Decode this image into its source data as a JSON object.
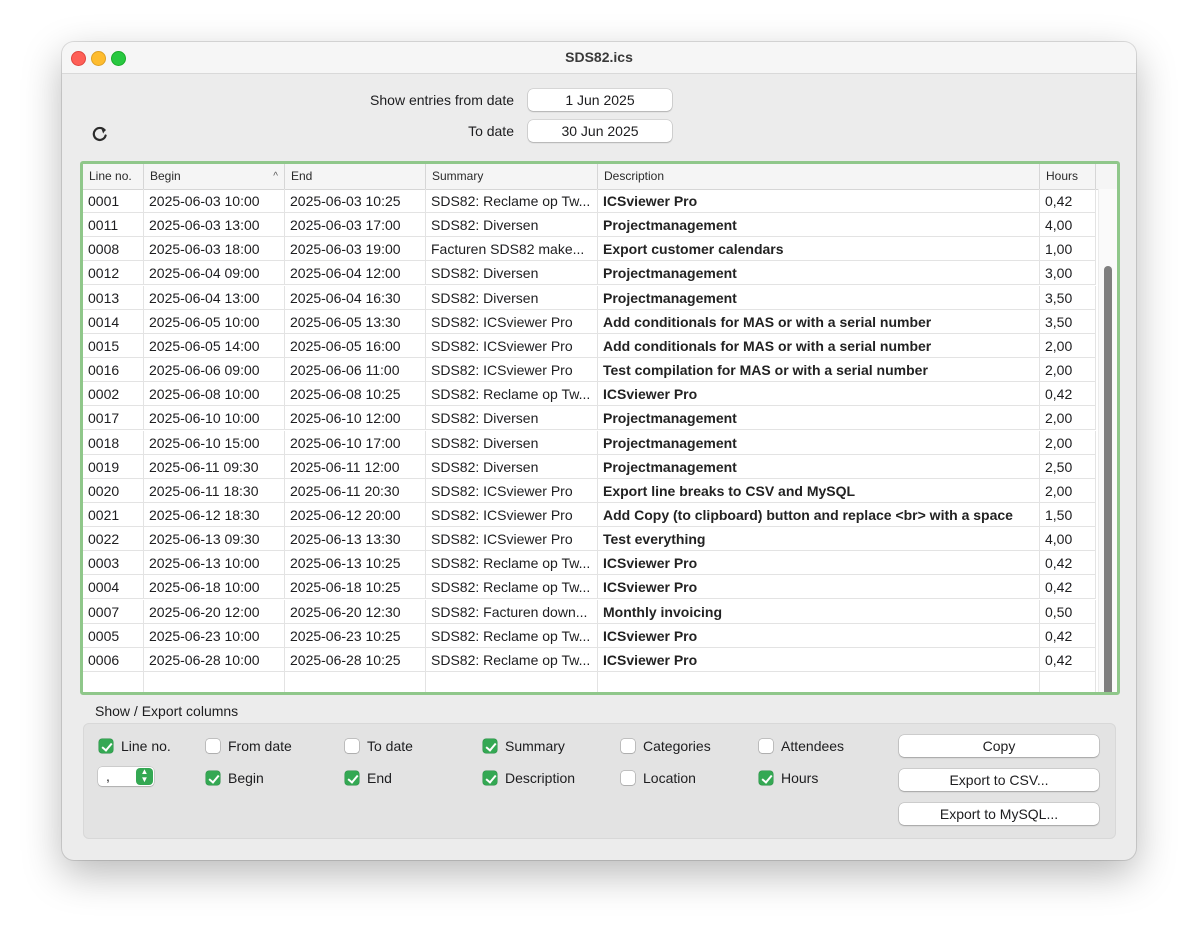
{
  "window": {
    "title": "SDS82.ics"
  },
  "filters": {
    "from_label": "Show entries from date",
    "from_value": "1 Jun 2025",
    "to_label": "To date",
    "to_value": "30 Jun 2025"
  },
  "table": {
    "columns": [
      "Line no.",
      "Begin",
      "End",
      "Summary",
      "Description",
      "Hours"
    ],
    "sort_indicator": "^",
    "rows": [
      {
        "line": "0001",
        "begin": "2025-06-03 10:00",
        "end": "2025-06-03 10:25",
        "summary": "SDS82: Reclame op Tw...",
        "description": "ICSviewer Pro",
        "hours": "0,42"
      },
      {
        "line": "0011",
        "begin": "2025-06-03 13:00",
        "end": "2025-06-03 17:00",
        "summary": "SDS82: Diversen",
        "description": "Projectmanagement",
        "hours": "4,00"
      },
      {
        "line": "0008",
        "begin": "2025-06-03 18:00",
        "end": "2025-06-03 19:00",
        "summary": "Facturen SDS82 make...",
        "description": "Export customer calendars",
        "hours": "1,00"
      },
      {
        "line": "0012",
        "begin": "2025-06-04 09:00",
        "end": "2025-06-04 12:00",
        "summary": "SDS82: Diversen",
        "description": "Projectmanagement",
        "hours": "3,00"
      },
      {
        "line": "0013",
        "begin": "2025-06-04 13:00",
        "end": "2025-06-04 16:30",
        "summary": "SDS82: Diversen",
        "description": "Projectmanagement",
        "hours": "3,50"
      },
      {
        "line": "0014",
        "begin": "2025-06-05 10:00",
        "end": "2025-06-05 13:30",
        "summary": "SDS82: ICSviewer Pro",
        "description": "Add conditionals for MAS or with a serial number",
        "hours": "3,50"
      },
      {
        "line": "0015",
        "begin": "2025-06-05 14:00",
        "end": "2025-06-05 16:00",
        "summary": "SDS82: ICSviewer Pro",
        "description": "Add conditionals for MAS or with a serial number",
        "hours": "2,00"
      },
      {
        "line": "0016",
        "begin": "2025-06-06 09:00",
        "end": "2025-06-06 11:00",
        "summary": "SDS82: ICSviewer Pro",
        "description": "Test compilation for MAS or with a serial number",
        "hours": "2,00"
      },
      {
        "line": "0002",
        "begin": "2025-06-08 10:00",
        "end": "2025-06-08 10:25",
        "summary": "SDS82: Reclame op Tw...",
        "description": "ICSviewer Pro",
        "hours": "0,42"
      },
      {
        "line": "0017",
        "begin": "2025-06-10 10:00",
        "end": "2025-06-10 12:00",
        "summary": "SDS82: Diversen",
        "description": "Projectmanagement",
        "hours": "2,00"
      },
      {
        "line": "0018",
        "begin": "2025-06-10 15:00",
        "end": "2025-06-10 17:00",
        "summary": "SDS82: Diversen",
        "description": "Projectmanagement",
        "hours": "2,00"
      },
      {
        "line": "0019",
        "begin": "2025-06-11 09:30",
        "end": "2025-06-11 12:00",
        "summary": "SDS82: Diversen",
        "description": "Projectmanagement",
        "hours": "2,50"
      },
      {
        "line": "0020",
        "begin": "2025-06-11 18:30",
        "end": "2025-06-11 20:30",
        "summary": "SDS82: ICSviewer Pro",
        "description": "Export line breaks to CSV and MySQL",
        "hours": "2,00"
      },
      {
        "line": "0021",
        "begin": "2025-06-12 18:30",
        "end": "2025-06-12 20:00",
        "summary": "SDS82: ICSviewer Pro",
        "description": "Add Copy (to clipboard) button and replace <br> with a space",
        "hours": "1,50"
      },
      {
        "line": "0022",
        "begin": "2025-06-13 09:30",
        "end": "2025-06-13 13:30",
        "summary": "SDS82: ICSviewer Pro",
        "description": "Test everything",
        "hours": "4,00"
      },
      {
        "line": "0003",
        "begin": "2025-06-13 10:00",
        "end": "2025-06-13 10:25",
        "summary": "SDS82: Reclame op Tw...",
        "description": "ICSviewer Pro",
        "hours": "0,42"
      },
      {
        "line": "0004",
        "begin": "2025-06-18 10:00",
        "end": "2025-06-18 10:25",
        "summary": "SDS82: Reclame op Tw...",
        "description": "ICSviewer Pro",
        "hours": "0,42"
      },
      {
        "line": "0007",
        "begin": "2025-06-20 12:00",
        "end": "2025-06-20 12:30",
        "summary": "SDS82: Facturen down...",
        "description": "Monthly invoicing",
        "hours": "0,50"
      },
      {
        "line": "0005",
        "begin": "2025-06-23 10:00",
        "end": "2025-06-23 10:25",
        "summary": "SDS82: Reclame op Tw...",
        "description": "ICSviewer Pro",
        "hours": "0,42"
      },
      {
        "line": "0006",
        "begin": "2025-06-28 10:00",
        "end": "2025-06-28 10:25",
        "summary": "SDS82: Reclame op Tw...",
        "description": "ICSviewer Pro",
        "hours": "0,42"
      }
    ]
  },
  "export": {
    "section_label": "Show / Export columns",
    "options": [
      {
        "label": "Line no.",
        "checked": true
      },
      {
        "label": "From date",
        "checked": false
      },
      {
        "label": "To date",
        "checked": false
      },
      {
        "label": "Summary",
        "checked": true
      },
      {
        "label": "Categories",
        "checked": false
      },
      {
        "label": "Attendees",
        "checked": false
      },
      {
        "label": "Begin",
        "checked": true
      },
      {
        "label": "End",
        "checked": true
      },
      {
        "label": "Description",
        "checked": true
      },
      {
        "label": "Location",
        "checked": false
      },
      {
        "label": "Hours",
        "checked": true
      }
    ],
    "separator_value": ",",
    "copy_button": "Copy",
    "csv_button": "Export to CSV...",
    "mysql_button": "Export to MySQL..."
  },
  "icons": {
    "refresh": "refresh-icon",
    "sort": "chevron-up-icon",
    "stepper": "stepper-icon"
  },
  "colors": {
    "accent": "#34a853",
    "table_border": "#8fc78a"
  }
}
